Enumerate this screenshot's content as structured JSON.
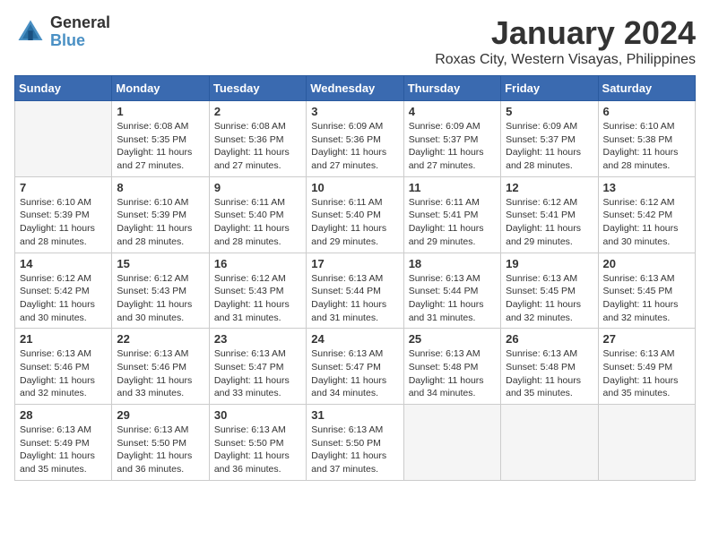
{
  "header": {
    "logo_general": "General",
    "logo_blue": "Blue",
    "month_title": "January 2024",
    "location": "Roxas City, Western Visayas, Philippines"
  },
  "weekdays": [
    "Sunday",
    "Monday",
    "Tuesday",
    "Wednesday",
    "Thursday",
    "Friday",
    "Saturday"
  ],
  "weeks": [
    [
      {
        "day": "",
        "empty": true
      },
      {
        "day": "1",
        "sunrise": "6:08 AM",
        "sunset": "5:35 PM",
        "daylight": "11 hours and 27 minutes."
      },
      {
        "day": "2",
        "sunrise": "6:08 AM",
        "sunset": "5:36 PM",
        "daylight": "11 hours and 27 minutes."
      },
      {
        "day": "3",
        "sunrise": "6:09 AM",
        "sunset": "5:36 PM",
        "daylight": "11 hours and 27 minutes."
      },
      {
        "day": "4",
        "sunrise": "6:09 AM",
        "sunset": "5:37 PM",
        "daylight": "11 hours and 27 minutes."
      },
      {
        "day": "5",
        "sunrise": "6:09 AM",
        "sunset": "5:37 PM",
        "daylight": "11 hours and 28 minutes."
      },
      {
        "day": "6",
        "sunrise": "6:10 AM",
        "sunset": "5:38 PM",
        "daylight": "11 hours and 28 minutes."
      }
    ],
    [
      {
        "day": "7",
        "sunrise": "6:10 AM",
        "sunset": "5:39 PM",
        "daylight": "11 hours and 28 minutes."
      },
      {
        "day": "8",
        "sunrise": "6:10 AM",
        "sunset": "5:39 PM",
        "daylight": "11 hours and 28 minutes."
      },
      {
        "day": "9",
        "sunrise": "6:11 AM",
        "sunset": "5:40 PM",
        "daylight": "11 hours and 28 minutes."
      },
      {
        "day": "10",
        "sunrise": "6:11 AM",
        "sunset": "5:40 PM",
        "daylight": "11 hours and 29 minutes."
      },
      {
        "day": "11",
        "sunrise": "6:11 AM",
        "sunset": "5:41 PM",
        "daylight": "11 hours and 29 minutes."
      },
      {
        "day": "12",
        "sunrise": "6:12 AM",
        "sunset": "5:41 PM",
        "daylight": "11 hours and 29 minutes."
      },
      {
        "day": "13",
        "sunrise": "6:12 AM",
        "sunset": "5:42 PM",
        "daylight": "11 hours and 30 minutes."
      }
    ],
    [
      {
        "day": "14",
        "sunrise": "6:12 AM",
        "sunset": "5:42 PM",
        "daylight": "11 hours and 30 minutes."
      },
      {
        "day": "15",
        "sunrise": "6:12 AM",
        "sunset": "5:43 PM",
        "daylight": "11 hours and 30 minutes."
      },
      {
        "day": "16",
        "sunrise": "6:12 AM",
        "sunset": "5:43 PM",
        "daylight": "11 hours and 31 minutes."
      },
      {
        "day": "17",
        "sunrise": "6:13 AM",
        "sunset": "5:44 PM",
        "daylight": "11 hours and 31 minutes."
      },
      {
        "day": "18",
        "sunrise": "6:13 AM",
        "sunset": "5:44 PM",
        "daylight": "11 hours and 31 minutes."
      },
      {
        "day": "19",
        "sunrise": "6:13 AM",
        "sunset": "5:45 PM",
        "daylight": "11 hours and 32 minutes."
      },
      {
        "day": "20",
        "sunrise": "6:13 AM",
        "sunset": "5:45 PM",
        "daylight": "11 hours and 32 minutes."
      }
    ],
    [
      {
        "day": "21",
        "sunrise": "6:13 AM",
        "sunset": "5:46 PM",
        "daylight": "11 hours and 32 minutes."
      },
      {
        "day": "22",
        "sunrise": "6:13 AM",
        "sunset": "5:46 PM",
        "daylight": "11 hours and 33 minutes."
      },
      {
        "day": "23",
        "sunrise": "6:13 AM",
        "sunset": "5:47 PM",
        "daylight": "11 hours and 33 minutes."
      },
      {
        "day": "24",
        "sunrise": "6:13 AM",
        "sunset": "5:47 PM",
        "daylight": "11 hours and 34 minutes."
      },
      {
        "day": "25",
        "sunrise": "6:13 AM",
        "sunset": "5:48 PM",
        "daylight": "11 hours and 34 minutes."
      },
      {
        "day": "26",
        "sunrise": "6:13 AM",
        "sunset": "5:48 PM",
        "daylight": "11 hours and 35 minutes."
      },
      {
        "day": "27",
        "sunrise": "6:13 AM",
        "sunset": "5:49 PM",
        "daylight": "11 hours and 35 minutes."
      }
    ],
    [
      {
        "day": "28",
        "sunrise": "6:13 AM",
        "sunset": "5:49 PM",
        "daylight": "11 hours and 35 minutes."
      },
      {
        "day": "29",
        "sunrise": "6:13 AM",
        "sunset": "5:50 PM",
        "daylight": "11 hours and 36 minutes."
      },
      {
        "day": "30",
        "sunrise": "6:13 AM",
        "sunset": "5:50 PM",
        "daylight": "11 hours and 36 minutes."
      },
      {
        "day": "31",
        "sunrise": "6:13 AM",
        "sunset": "5:50 PM",
        "daylight": "11 hours and 37 minutes."
      },
      {
        "day": "",
        "empty": true
      },
      {
        "day": "",
        "empty": true
      },
      {
        "day": "",
        "empty": true
      }
    ]
  ]
}
